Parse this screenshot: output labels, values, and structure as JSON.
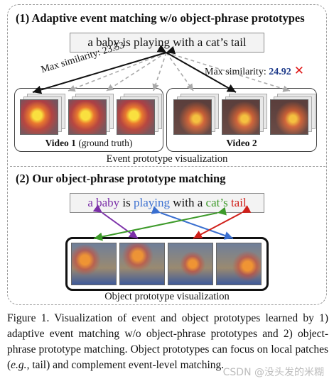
{
  "section1": {
    "title": "(1) Adaptive event matching w/o object-phrase prototypes",
    "query": "a baby is playing with a cat’s tail",
    "sim_left_label": "Max similarity: 23.53",
    "sim_right_label": "Max similarity: ",
    "sim_right_value": "24.92",
    "wrong_mark": "✕",
    "video1_label_bold": "Video 1",
    "video1_label_rest": " (ground truth)",
    "video2_label": "Video 2",
    "viz_label": "Event prototype visualization"
  },
  "section2": {
    "title": "(2) Our object-phrase prototype matching",
    "query_parts": [
      {
        "text": "a baby",
        "color": "#7b2fa8"
      },
      {
        "text": " is ",
        "color": "#111111"
      },
      {
        "text": "playing",
        "color": "#3a6fd0"
      },
      {
        "text": " with a ",
        "color": "#111111"
      },
      {
        "text": "cat’s",
        "color": "#3d9a2a"
      },
      {
        "text": " ",
        "color": "#111111"
      },
      {
        "text": "tail",
        "color": "#d0201a"
      }
    ],
    "viz_label": "Object prototype visualization"
  },
  "colors": {
    "purple": "#7b2fa8",
    "blue": "#3a6fd0",
    "green": "#3d9a2a",
    "red": "#d0201a",
    "dashed_gray": "#9a9a9a"
  },
  "caption": {
    "line1_a": "Figure 1. Visualization of event and object prototypes learned by 1) adaptive event matching w/o object-phrase prototypes and 2) object-phrase prototype matching. Object prototypes can focus on local patches (",
    "eg": "e.g.",
    "line1_b": ", tail) and complement event-level matching."
  },
  "watermark": "CSDN @没头发的米糊"
}
